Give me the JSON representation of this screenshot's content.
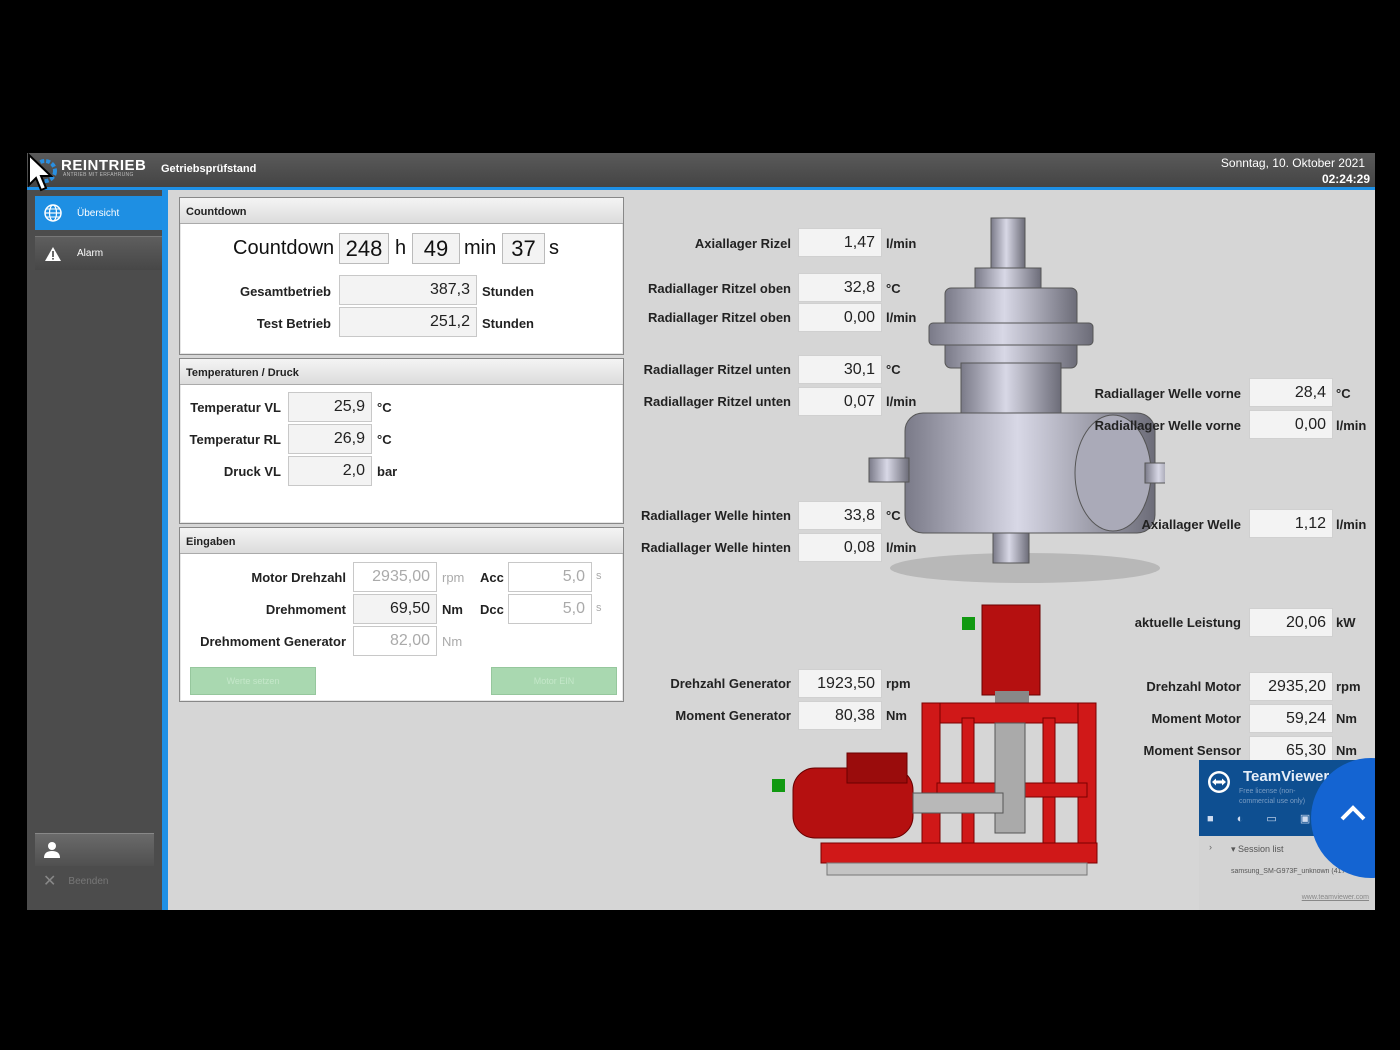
{
  "header": {
    "logo": "REINTRIEB",
    "logo_sub": "ANTRIEB MIT ERFAHRUNG",
    "title": "Getriebsprüfstand",
    "date": "Sonntag, 10. Oktober 2021",
    "time": "02:24:29"
  },
  "sidebar": {
    "items": [
      {
        "label": "Übersicht",
        "icon": "globe-icon"
      },
      {
        "label": "Alarm",
        "icon": "warning-icon"
      }
    ],
    "user_icon": "user-icon",
    "exit_label": "Beenden"
  },
  "countdown_panel": {
    "title": "Countdown",
    "label": "Countdown",
    "hours": "248",
    "h": "h",
    "minutes": "49",
    "min": "min",
    "seconds": "37",
    "s": "s",
    "rows": [
      {
        "label": "Gesamtbetrieb",
        "value": "387,3",
        "unit": "Stunden"
      },
      {
        "label": "Test Betrieb",
        "value": "251,2",
        "unit": "Stunden"
      }
    ]
  },
  "temp_panel": {
    "title": "Temperaturen / Druck",
    "rows": [
      {
        "label": "Temperatur VL",
        "value": "25,9",
        "unit": "°C"
      },
      {
        "label": "Temperatur RL",
        "value": "26,9",
        "unit": "°C"
      },
      {
        "label": "Druck VL",
        "value": "2,0",
        "unit": "bar"
      }
    ]
  },
  "input_panel": {
    "title": "Eingaben",
    "motor_label": "Motor Drehzahl",
    "motor_value": "2935,00",
    "motor_unit": "rpm",
    "acc_label": "Acc",
    "acc_value": "5,0",
    "acc_unit": "s",
    "torque_label": "Drehmoment",
    "torque_value": "69,50",
    "torque_unit": "Nm",
    "dcc_label": "Dcc",
    "dcc_value": "5,0",
    "dcc_unit": "s",
    "gen_label": "Drehmoment Generator",
    "gen_value": "82,00",
    "gen_unit": "Nm",
    "btn_left": "Werte setzen",
    "btn_right": "Motor EIN"
  },
  "measurements_left": [
    {
      "label": "Axiallager Rizel",
      "value": "1,47",
      "unit": "l/min"
    },
    {
      "label": "Radiallager Ritzel oben",
      "value": "32,8",
      "unit": "°C"
    },
    {
      "label": "Radiallager Ritzel oben",
      "value": "0,00",
      "unit": "l/min"
    },
    {
      "label": "Radiallager Ritzel unten",
      "value": "30,1",
      "unit": "°C"
    },
    {
      "label": "Radiallager Ritzel unten",
      "value": "0,07",
      "unit": "l/min"
    },
    {
      "label": "Radiallager Welle hinten",
      "value": "33,8",
      "unit": "°C"
    },
    {
      "label": "Radiallager Welle hinten",
      "value": "0,08",
      "unit": "l/min"
    }
  ],
  "measurements_right": [
    {
      "label": "Radiallager Welle vorne",
      "value": "28,4",
      "unit": "°C"
    },
    {
      "label": "Radiallager Welle vorne",
      "value": "0,00",
      "unit": "l/min"
    },
    {
      "label": "Axiallager Welle",
      "value": "1,12",
      "unit": "l/min"
    }
  ],
  "power": {
    "label": "aktuelle Leistung",
    "value": "20,06",
    "unit": "kW"
  },
  "generator": [
    {
      "label": "Drehzahl Generator",
      "value": "1923,50",
      "unit": "rpm"
    },
    {
      "label": "Moment Generator",
      "value": "80,38",
      "unit": "Nm"
    }
  ],
  "motor": [
    {
      "label": "Drehzahl Motor",
      "value": "2935,20",
      "unit": "rpm"
    },
    {
      "label": "Moment Motor",
      "value": "59,24",
      "unit": "Nm"
    },
    {
      "label": "Moment Sensor",
      "value": "65,30",
      "unit": "Nm"
    }
  ],
  "teamviewer": {
    "title": "TeamViewer",
    "subtitle": "Free license (non-commercial use only)",
    "session_list": "Session list",
    "session_item": "samsung_SM-G973F_unknown (417 ...",
    "url": "www.teamviewer.com"
  },
  "colors": {
    "accent": "#1e90e6",
    "status_ok": "#119911",
    "rig_red": "#c81818"
  }
}
